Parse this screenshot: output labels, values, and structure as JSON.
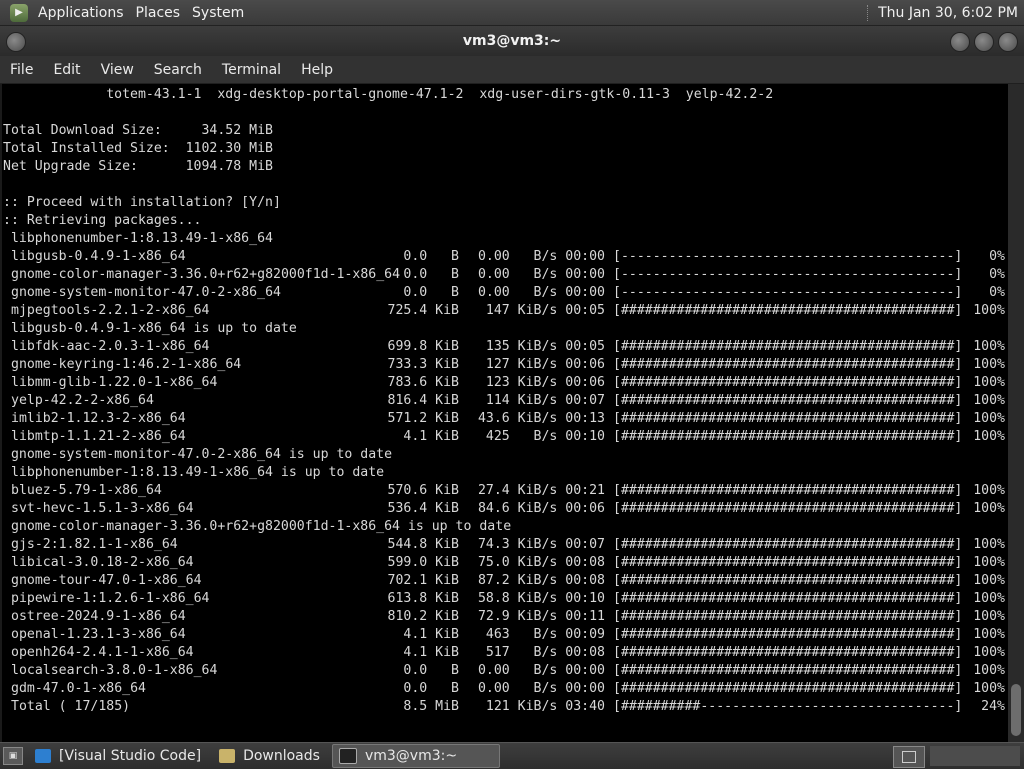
{
  "top_panel": {
    "menus": [
      "Applications",
      "Places",
      "System"
    ],
    "clock": "Thu Jan 30,  6:02 PM"
  },
  "window": {
    "title": "vm3@vm3:~"
  },
  "menubar": [
    "File",
    "Edit",
    "View",
    "Search",
    "Terminal",
    "Help"
  ],
  "terminal": {
    "header_lines": [
      "             totem-43.1-1  xdg-desktop-portal-gnome-47.1-2  xdg-user-dirs-gtk-0.11-3  yelp-42.2-2",
      "",
      "Total Download Size:     34.52 MiB",
      "Total Installed Size:  1102.30 MiB",
      "Net Upgrade Size:      1094.78 MiB",
      "",
      ":: Proceed with installation? [Y/n]",
      ":: Retrieving packages...",
      " libphonenumber-1:8.13.49-1-x86_64"
    ],
    "progress_lines": [
      {
        "name": "libgusb-0.4.9-1-x86_64",
        "size": "0.0   B",
        "rate": "0.00   B/s 00:00",
        "bar": "[------------------------------------------]",
        "pct": "0%"
      },
      {
        "name": "gnome-color-manager-3.36.0+r62+g82000f1d-1-x86_64",
        "size": "0.0   B",
        "rate": "0.00   B/s 00:00",
        "bar": "[------------------------------------------]",
        "pct": "0%"
      },
      {
        "name": "gnome-system-monitor-47.0-2-x86_64",
        "size": "0.0   B",
        "rate": "0.00   B/s 00:00",
        "bar": "[------------------------------------------]",
        "pct": "0%"
      },
      {
        "name": "mjpegtools-2.2.1-2-x86_64",
        "size": "725.4 KiB",
        "rate": "147 KiB/s 00:05",
        "bar": "[##########################################]",
        "pct": "100%"
      },
      {
        "text": " libgusb-0.4.9-1-x86_64 is up to date"
      },
      {
        "name": "libfdk-aac-2.0.3-1-x86_64",
        "size": "699.8 KiB",
        "rate": "135 KiB/s 00:05",
        "bar": "[##########################################]",
        "pct": "100%"
      },
      {
        "name": "gnome-keyring-1:46.2-1-x86_64",
        "size": "733.3 KiB",
        "rate": "127 KiB/s 00:06",
        "bar": "[##########################################]",
        "pct": "100%"
      },
      {
        "name": "libmm-glib-1.22.0-1-x86_64",
        "size": "783.6 KiB",
        "rate": "123 KiB/s 00:06",
        "bar": "[##########################################]",
        "pct": "100%"
      },
      {
        "name": "yelp-42.2-2-x86_64",
        "size": "816.4 KiB",
        "rate": "114 KiB/s 00:07",
        "bar": "[##########################################]",
        "pct": "100%"
      },
      {
        "name": "imlib2-1.12.3-2-x86_64",
        "size": "571.2 KiB",
        "rate": "43.6 KiB/s 00:13",
        "bar": "[##########################################]",
        "pct": "100%"
      },
      {
        "name": "libmtp-1.1.21-2-x86_64",
        "size": "4.1 KiB",
        "rate": "425   B/s 00:10",
        "bar": "[##########################################]",
        "pct": "100%"
      },
      {
        "text": " gnome-system-monitor-47.0-2-x86_64 is up to date"
      },
      {
        "text": " libphonenumber-1:8.13.49-1-x86_64 is up to date"
      },
      {
        "name": "bluez-5.79-1-x86_64",
        "size": "570.6 KiB",
        "rate": "27.4 KiB/s 00:21",
        "bar": "[##########################################]",
        "pct": "100%"
      },
      {
        "name": "svt-hevc-1.5.1-3-x86_64",
        "size": "536.4 KiB",
        "rate": "84.6 KiB/s 00:06",
        "bar": "[##########################################]",
        "pct": "100%"
      },
      {
        "text": " gnome-color-manager-3.36.0+r62+g82000f1d-1-x86_64 is up to date"
      },
      {
        "name": "gjs-2:1.82.1-1-x86_64",
        "size": "544.8 KiB",
        "rate": "74.3 KiB/s 00:07",
        "bar": "[##########################################]",
        "pct": "100%"
      },
      {
        "name": "libical-3.0.18-2-x86_64",
        "size": "599.0 KiB",
        "rate": "75.0 KiB/s 00:08",
        "bar": "[##########################################]",
        "pct": "100%"
      },
      {
        "name": "gnome-tour-47.0-1-x86_64",
        "size": "702.1 KiB",
        "rate": "87.2 KiB/s 00:08",
        "bar": "[##########################################]",
        "pct": "100%"
      },
      {
        "name": "pipewire-1:1.2.6-1-x86_64",
        "size": "613.8 KiB",
        "rate": "58.8 KiB/s 00:10",
        "bar": "[##########################################]",
        "pct": "100%"
      },
      {
        "name": "ostree-2024.9-1-x86_64",
        "size": "810.2 KiB",
        "rate": "72.9 KiB/s 00:11",
        "bar": "[##########################################]",
        "pct": "100%"
      },
      {
        "name": "openal-1.23.1-3-x86_64",
        "size": "4.1 KiB",
        "rate": "463   B/s 00:09",
        "bar": "[##########################################]",
        "pct": "100%"
      },
      {
        "name": "openh264-2.4.1-1-x86_64",
        "size": "4.1 KiB",
        "rate": "517   B/s 00:08",
        "bar": "[##########################################]",
        "pct": "100%"
      },
      {
        "name": "localsearch-3.8.0-1-x86_64",
        "size": "0.0   B",
        "rate": "0.00   B/s 00:00",
        "bar": "[##########################################]",
        "pct": "100%"
      },
      {
        "name": "gdm-47.0-1-x86_64",
        "size": "0.0   B",
        "rate": "0.00   B/s 00:00",
        "bar": "[##########################################]",
        "pct": "100%"
      },
      {
        "name": "Total ( 17/185)",
        "size": "8.5 MiB",
        "rate": "121 KiB/s 03:40",
        "bar": "[##########--------------------------------]",
        "pct": "24%"
      }
    ]
  },
  "taskbar": {
    "tasks": [
      {
        "label": "[Visual Studio Code]",
        "icon": "vscode-icon",
        "active": false
      },
      {
        "label": "Downloads",
        "icon": "folder-icon",
        "active": false
      },
      {
        "label": "vm3@vm3:~",
        "icon": "terminal-icon",
        "active": true
      }
    ]
  }
}
